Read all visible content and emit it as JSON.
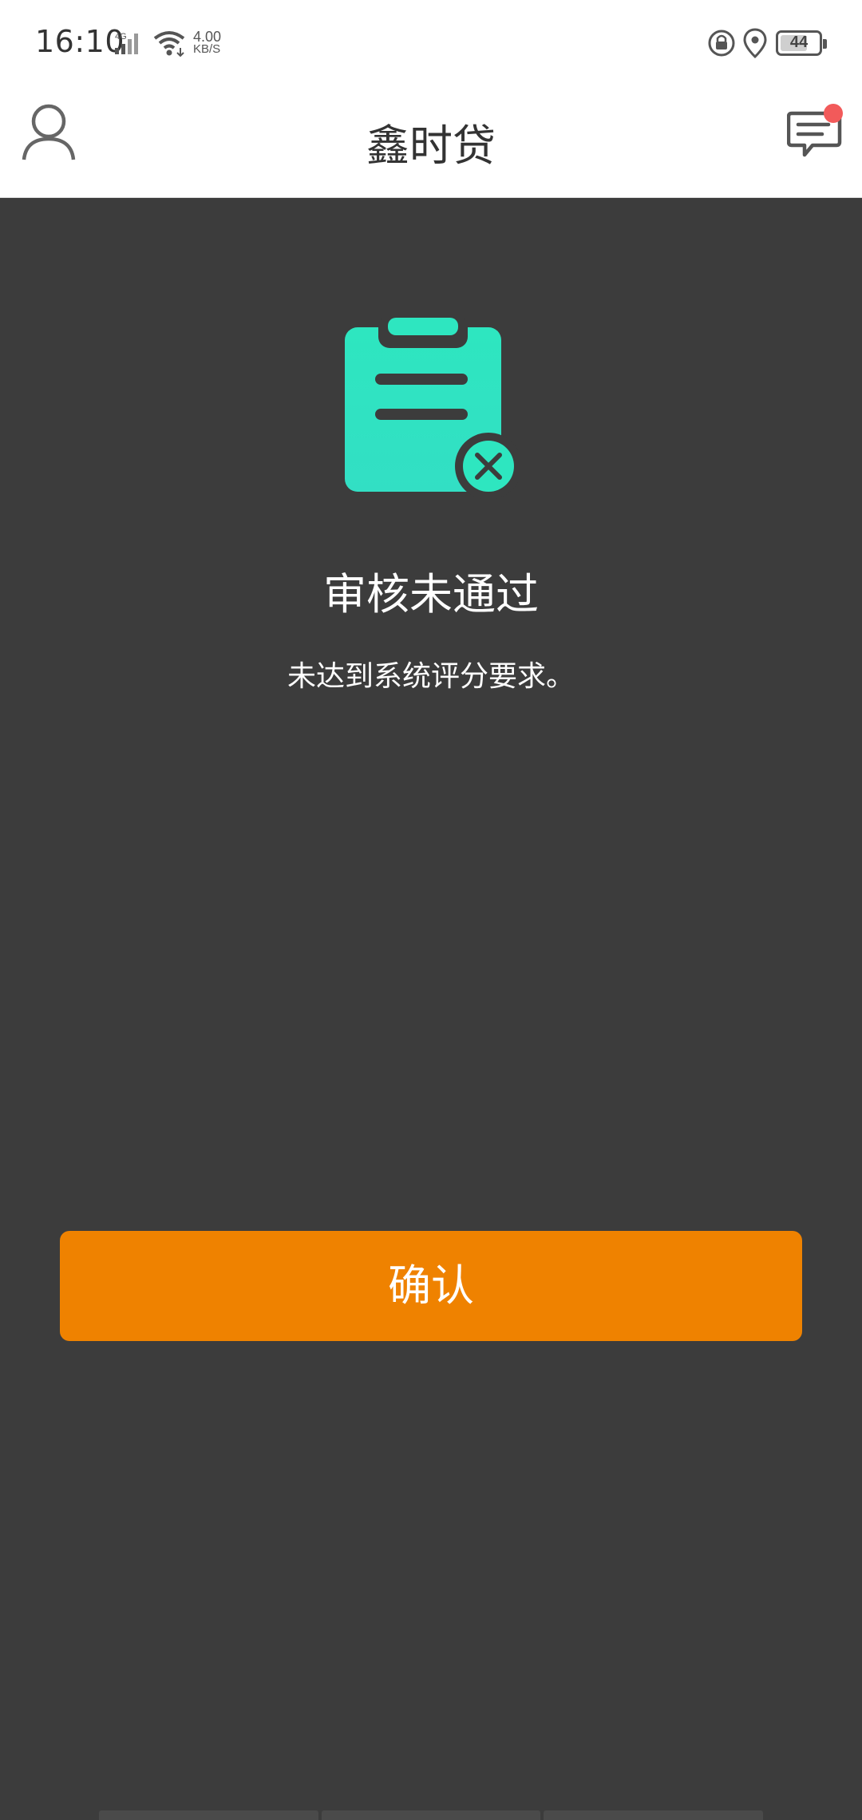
{
  "status_bar": {
    "time": "16:10",
    "network_type": "4G",
    "net_speed_value": "4.00",
    "net_speed_unit": "KB/S",
    "battery": "44",
    "icons": [
      "signal-icon",
      "wifi-icon",
      "lock-rotation-icon",
      "location-icon",
      "battery-icon"
    ]
  },
  "header": {
    "title": "鑫时贷",
    "left_icon": "user-profile-icon",
    "right_icon": "message-icon",
    "has_notification": true
  },
  "result": {
    "icon": "clipboard-rejected-icon",
    "title": "审核未通过",
    "description": "未达到系统评分要求。"
  },
  "actions": {
    "confirm_label": "确认"
  },
  "colors": {
    "background": "#3c3c3c",
    "accent_teal": "#2ee6c0",
    "button_orange": "#ef8200",
    "notification_red": "#f25a5a"
  }
}
